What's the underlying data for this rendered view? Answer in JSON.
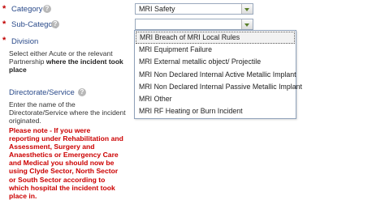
{
  "form": {
    "category": {
      "required": "*",
      "label": "Category",
      "help_icon": "?",
      "selected": "MRI Safety"
    },
    "subcategory": {
      "required": "*",
      "label": "Sub-Category",
      "help_icon": "?",
      "selected": "",
      "options": [
        "MRI Breach of MRI Local Rules",
        "MRI Equipment Failure",
        "MRI External metallic object/ Projectile",
        "MRI Non Declared Internal Active Metallic Implant",
        "MRI Non Declared Internal Passive Metallic Implant",
        "MRI Other",
        "MRI RF Heating or Burn Incident"
      ],
      "highlighted_option": "MRI Breach of MRI Local Rules"
    },
    "division": {
      "required": "*",
      "label": "Division",
      "hint_line1": "Select either Acute or the relevant",
      "hint_line2_plain": "Partnership ",
      "hint_line2_bold": "where the incident took",
      "hint_line3_bold": "place"
    },
    "directorate": {
      "label": "Directorate/Service",
      "help_icon": "?",
      "hint_line1": "Enter the name of the",
      "hint_line2": "Directorate/Service where the incident",
      "hint_line3": "originated."
    },
    "note_lines": [
      "Please note - If you were",
      "reporting under Rehabilitation and",
      "Assessment, Surgery and",
      "Anaesthetics or Emergency Care",
      "and Medical you should now be",
      "using Clyde Sector, North Sector",
      "or South Sector according to",
      "which hospital the incident took",
      "place in."
    ]
  },
  "colors": {
    "required_star": "#c00000",
    "label": "#2a4a8a",
    "warning": "#cc0000"
  }
}
